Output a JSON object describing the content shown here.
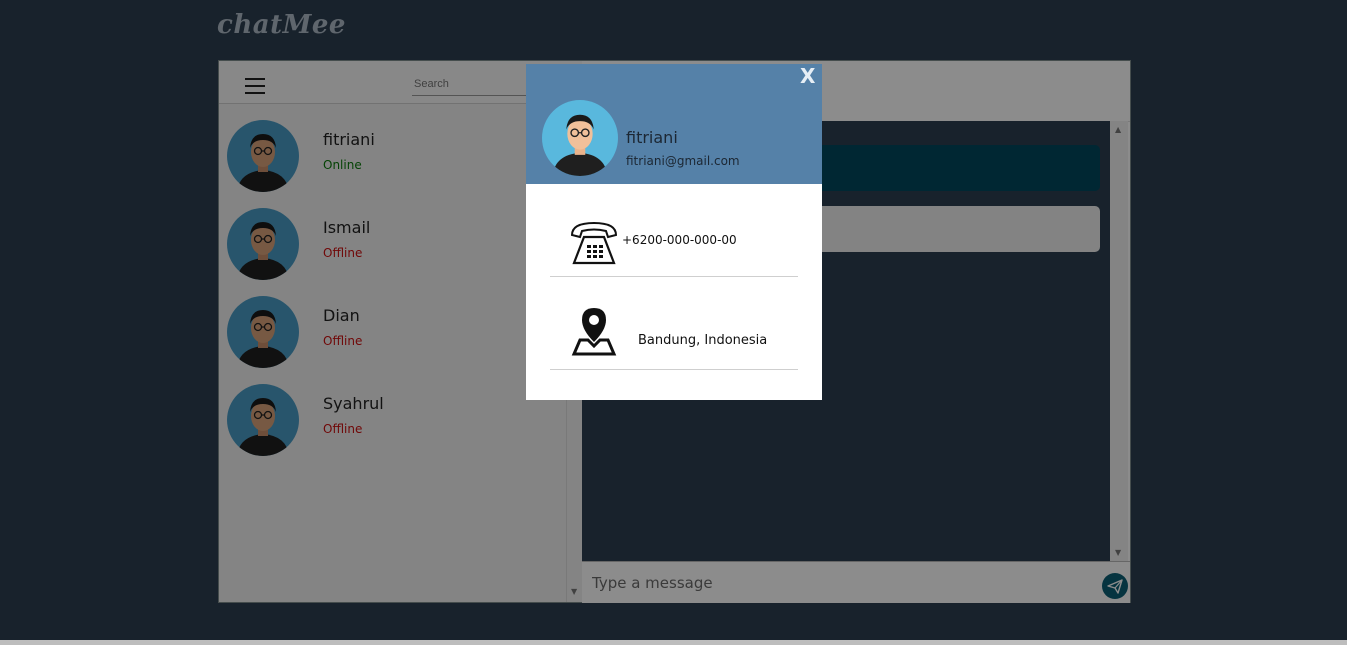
{
  "brand": "chatMee",
  "search": {
    "placeholder": "Search"
  },
  "contacts": [
    {
      "name": "fitriani",
      "status": "Online"
    },
    {
      "name": "Ismail",
      "status": "Offline"
    },
    {
      "name": "Dian",
      "status": "Offline"
    },
    {
      "name": "Syahrul",
      "status": "Offline"
    }
  ],
  "composer": {
    "placeholder": "Type a message"
  },
  "profile": {
    "close_label": "X",
    "name": "fitriani",
    "email": "fitriani@gmail.com",
    "phone": "+6200-000-000-00",
    "location": "Bandung, Indonesia"
  },
  "icons": {
    "menu": "hamburger-menu-icon",
    "send": "paper-plane-icon",
    "phone": "telephone-icon",
    "location": "map-pin-icon"
  },
  "colors": {
    "background": "#2c3e50",
    "modal_header": "#5581a8",
    "online": "#0a7a0a",
    "offline": "#cc1010",
    "send_button": "#0b5f75"
  }
}
